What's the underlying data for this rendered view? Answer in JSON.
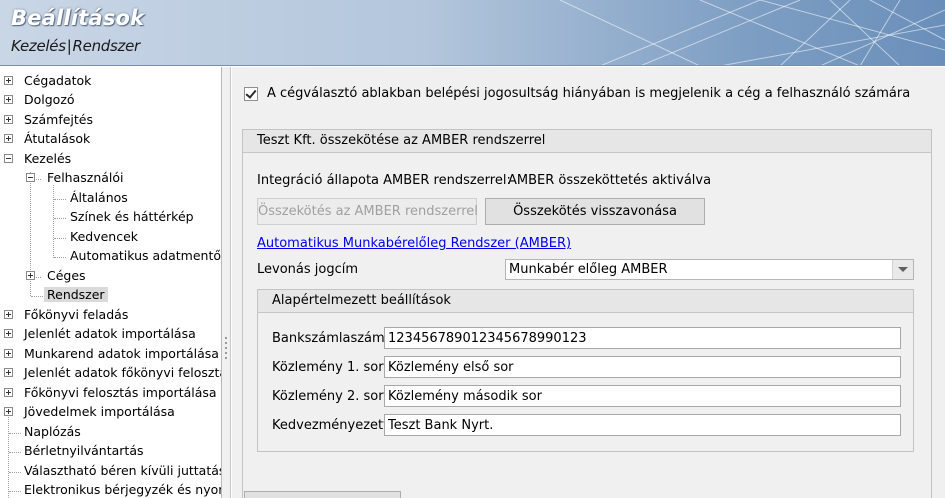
{
  "header": {
    "title": "Beállítások",
    "subtitle_part1": "Kezelés",
    "subtitle_sep": "|",
    "subtitle_part2": "Rendszer"
  },
  "tree": {
    "items": [
      {
        "label": "Cégadatok",
        "expander": "plus"
      },
      {
        "label": "Dolgozó",
        "expander": "plus"
      },
      {
        "label": "Számfejtés",
        "expander": "plus"
      },
      {
        "label": "Átutalások",
        "expander": "plus"
      },
      {
        "label": "Kezelés",
        "expander": "minus"
      },
      {
        "label": "Felhasználói",
        "expander": "minus"
      },
      {
        "label": "Általános"
      },
      {
        "label": "Színek és háttérkép"
      },
      {
        "label": "Kedvencek"
      },
      {
        "label": "Automatikus adatmentő"
      },
      {
        "label": "Céges",
        "expander": "plus"
      },
      {
        "label": "Rendszer",
        "selected": true
      },
      {
        "label": "Főkönyvi feladás",
        "expander": "plus"
      },
      {
        "label": "Jelenlét adatok importálása",
        "expander": "plus"
      },
      {
        "label": "Munkarend adatok importálása",
        "expander": "plus"
      },
      {
        "label": "Jelenlét adatok főkönyvi felosztá",
        "expander": "plus"
      },
      {
        "label": "Főkönyvi felosztás importálása",
        "expander": "plus"
      },
      {
        "label": "Jövedelmek importálása",
        "expander": "plus"
      },
      {
        "label": "Naplózás"
      },
      {
        "label": "Bérletnyilvántartás"
      },
      {
        "label": "Választható béren kívüli juttatás"
      },
      {
        "label": "Elektronikus bérjegyzék és nyom"
      }
    ]
  },
  "settings": {
    "checkbox_label": "A cégválasztó ablakban belépési jogosultság hiányában is megjelenik a cég a felhasználó számára",
    "checkbox_checked": true
  },
  "amber": {
    "group_title": "Teszt Kft. összekötése az AMBER rendszerrel",
    "status_label": "Integráció állapota AMBER rendszerrel:",
    "status_value": "AMBER összeköttetés aktiválva",
    "connect_button": "Összekötés az AMBER rendszerrel",
    "revoke_button": "Összekötés visszavonása",
    "link_text": "Automatikus Munkabérelőleg Rendszer (AMBER)",
    "deduction_label": "Levonás jogcím",
    "deduction_value": "Munkabér előleg AMBER",
    "defaults": {
      "title": "Alapértelmezett beállítások",
      "bank_label": "Bankszámlaszám",
      "bank_value": "123456789012345678990123",
      "memo1_label": "Közlemény 1. sor",
      "memo1_value": "Közlemény első sor",
      "memo2_label": "Közlemény 2. sor",
      "memo2_value": "Közlemény második sor",
      "beneficiary_label": "Kedvezményezett",
      "beneficiary_value": "Teszt Bank Nyrt."
    }
  }
}
